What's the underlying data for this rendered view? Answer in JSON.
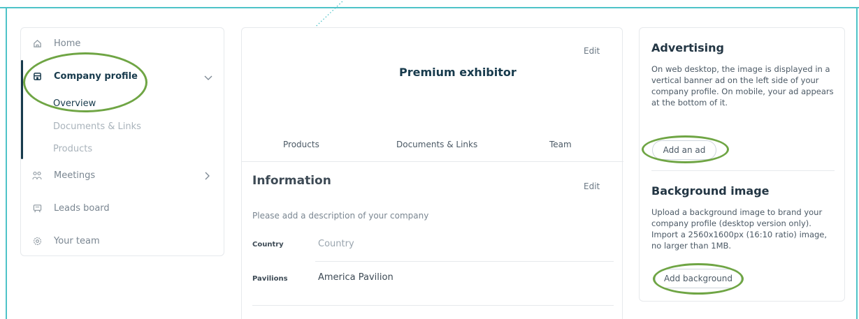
{
  "sidebar": {
    "items": [
      {
        "label": "Home",
        "icon": "home-icon"
      },
      {
        "label": "Company profile",
        "icon": "store-icon"
      },
      {
        "label": "Meetings",
        "icon": "meetings-icon"
      },
      {
        "label": "Leads board",
        "icon": "leads-board-icon"
      },
      {
        "label": "Your team",
        "icon": "team-gear-icon"
      }
    ],
    "subitems": [
      {
        "label": "Overview"
      },
      {
        "label": "Documents & Links"
      },
      {
        "label": "Products"
      }
    ]
  },
  "banner": {
    "title": "Premium exhibitor",
    "edit_label": "Edit"
  },
  "tabs": [
    {
      "label": "Products"
    },
    {
      "label": "Documents & Links"
    },
    {
      "label": "Team"
    }
  ],
  "information": {
    "title": "Information",
    "edit_label": "Edit",
    "description_placeholder": "Please add a description of your company",
    "rows": [
      {
        "label": "Country",
        "value": "Country"
      },
      {
        "label": "Pavilions",
        "value": "America Pavilion"
      }
    ]
  },
  "advertising": {
    "title": "Advertising",
    "text": "On web desktop, the image is displayed in a vertical banner ad on the left side of your company profile. On mobile, your ad appears at the bottom of it.",
    "button": "Add an ad"
  },
  "background": {
    "title": "Background image",
    "text": "Upload a background image to brand your company profile (desktop version only). Import a 2560x1600px (16:10 ratio) image, no larger than 1MB.",
    "button": "Add background"
  },
  "colors": {
    "accent_teal": "#4ec3c8",
    "highlight_green": "#6fa544",
    "navy": "#173a4c"
  }
}
